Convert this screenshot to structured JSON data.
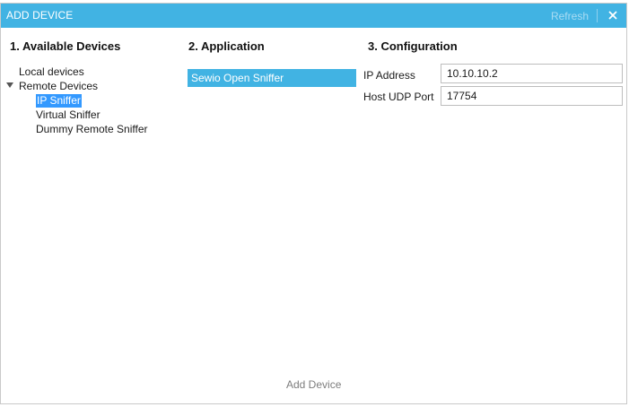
{
  "titlebar": {
    "title": "ADD DEVICE",
    "refresh_label": "Refresh",
    "close_icon": "close-icon",
    "background_color": "#41b3e3"
  },
  "sections": {
    "devices_heading": "1. Available Devices",
    "application_heading": "2. Application",
    "configuration_heading": "3. Configuration"
  },
  "devices": {
    "local": "Local devices",
    "remote": {
      "label": "Remote Devices",
      "expanded": true,
      "children": [
        "IP Sniffer",
        "Virtual Sniffer",
        "Dummy Remote Sniffer"
      ],
      "selected": "IP Sniffer"
    }
  },
  "applications": {
    "items": [
      "Sewio Open Sniffer"
    ],
    "selected": "Sewio Open Sniffer"
  },
  "configuration": {
    "ip_label": "IP Address",
    "ip_value": "10.10.10.2",
    "port_label": "Host UDP Port",
    "port_value": "17754"
  },
  "footer": {
    "add_label": "Add Device"
  },
  "colors": {
    "accent": "#41b3e3",
    "tree_selection": "#3399ff"
  }
}
